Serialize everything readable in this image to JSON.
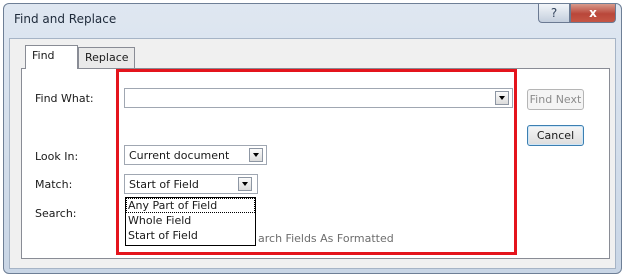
{
  "window": {
    "title": "Find and Replace"
  },
  "titlebar": {
    "help_glyph": "?",
    "close_glyph": "x"
  },
  "tabs": [
    {
      "label": "Find"
    },
    {
      "label": "Replace"
    }
  ],
  "find_what": {
    "label": "Find What:",
    "value": ""
  },
  "look_in": {
    "label": "Look In:",
    "value": "Current document"
  },
  "match": {
    "label": "Match:",
    "value": "Start of Field",
    "options": [
      "Any Part of Field",
      "Whole Field",
      "Start of Field"
    ]
  },
  "search": {
    "label": "Search:"
  },
  "search_formatted_hint": "arch Fields As Formatted",
  "buttons": {
    "find_next": "Find Next",
    "cancel": "Cancel"
  },
  "colors": {
    "highlight": "#e4141c",
    "selection": "#ffffff"
  }
}
